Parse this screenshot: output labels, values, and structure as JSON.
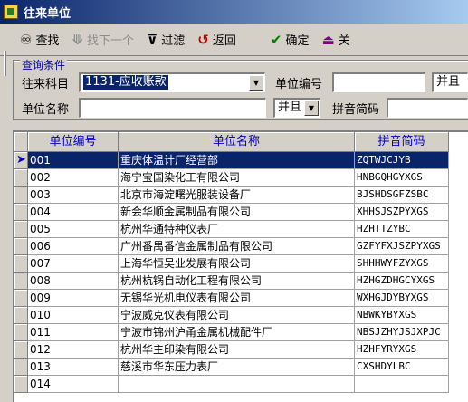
{
  "window": {
    "title": "往来单位"
  },
  "toolbar": {
    "find": "查找",
    "find_next": "找下一个",
    "filter": "过滤",
    "back": "返回",
    "ok": "确定",
    "close": "关"
  },
  "query": {
    "legend": "查询条件",
    "subject_label": "往来科目",
    "subject_value": "1131-应收账款",
    "unit_code_label": "单位编号",
    "unit_code_value": "",
    "unit_code_op": "并且",
    "unit_name_label": "单位名称",
    "unit_name_value": "",
    "unit_name_op": "并且",
    "pinyin_label": "拼音简码",
    "pinyin_value": ""
  },
  "grid": {
    "columns": [
      "单位编号",
      "单位名称",
      "拼音简码"
    ],
    "rows": [
      [
        "001",
        "重庆体温计厂经营部",
        "ZQTWJCJYB"
      ],
      [
        "002",
        "海宁宝国染化工有限公司",
        "HNBGQHGYXGS"
      ],
      [
        "003",
        "北京市海淀曙光服装设备厂",
        "BJSHDSGFZSBC"
      ],
      [
        "004",
        "新会华顺金属制品有限公司",
        "XHHSJSZPYXGS"
      ],
      [
        "005",
        "杭州华通特种仪表厂",
        "HZHTTZYBC"
      ],
      [
        "006",
        "广州番禺番信金属制品有限公司",
        "GZFYFXJSZPYXGS"
      ],
      [
        "007",
        "上海华恒吴业发展有限公司",
        "SHHHWYFZYXGS"
      ],
      [
        "008",
        "杭州杭锅自动化工程有限公司",
        "HZHGZDHGCYXGS"
      ],
      [
        "009",
        "无锡华光机电仪表有限公司",
        "WXHGJDYBYXGS"
      ],
      [
        "010",
        "宁波威克仪表有限公司",
        "NBWKYBYXGS"
      ],
      [
        "011",
        "宁波市锦州沪甬金属机械配件厂",
        "NBSJZHYJSJXPJC"
      ],
      [
        "012",
        "杭州华主印染有限公司",
        "HZHFYRYXGS"
      ],
      [
        "013",
        "慈溪市华东压力表厂",
        "CXSHDYLBC"
      ],
      [
        "014",
        "",
        ""
      ]
    ],
    "selected_row": 0
  },
  "colors": {
    "title_start": "#0a246a",
    "title_end": "#a6caf0",
    "selection": "#0a246a",
    "header_text": "#0000c0"
  }
}
